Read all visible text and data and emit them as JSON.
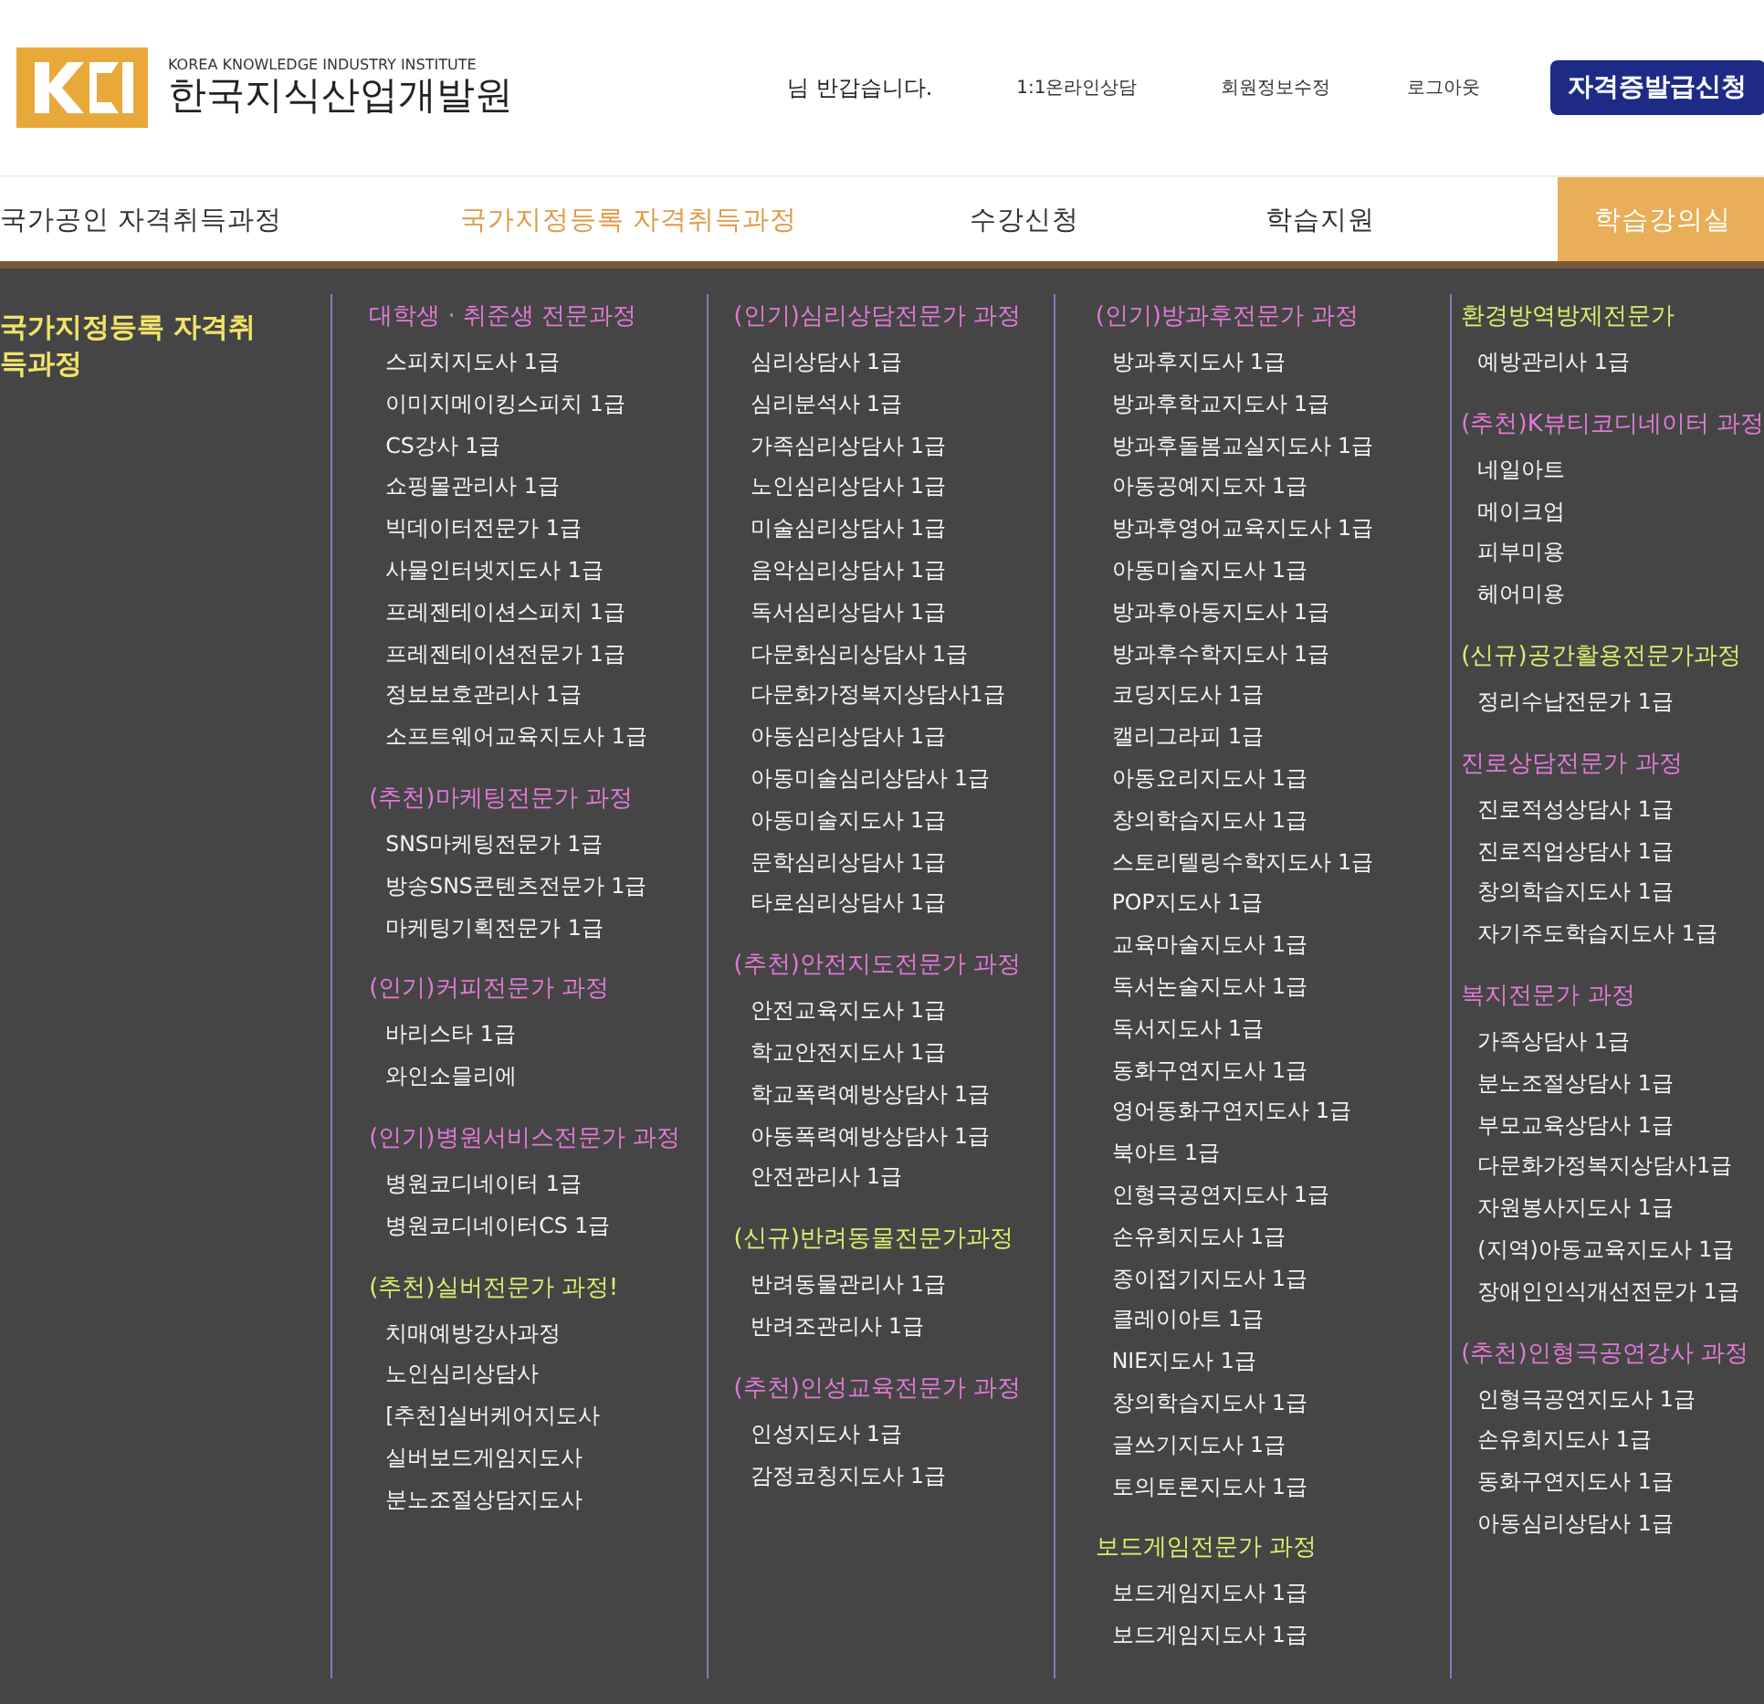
{
  "header": {
    "logo": {
      "subtitle": "KOREA KNOWLEDGE INDUSTRY INSTITUTE",
      "name": "한국지식산업개발원"
    },
    "greeting": "님 반갑습니다.",
    "links": [
      "1:1온라인상담",
      "회원정보수정",
      "로그아웃"
    ],
    "cta": "자격증발급신청"
  },
  "nav": [
    {
      "label": "국가공인 자격취득과정",
      "selected": false,
      "kind": "plain"
    },
    {
      "label": "국가지정등록 자격취득과정",
      "selected": true,
      "kind": "plain"
    },
    {
      "label": "수강신청",
      "selected": false,
      "kind": "plain"
    },
    {
      "label": "학습지원",
      "selected": false,
      "kind": "plain"
    },
    {
      "label": "학습강의실",
      "selected": false,
      "kind": "box"
    }
  ],
  "menu": {
    "title": "국가지정등록 자격취득과정",
    "columns": [
      {
        "groups": [
          {
            "title": "대학생 · 취준생 전문과정",
            "color": "#e07ad8",
            "items": [
              "스피치지도사 1급",
              "이미지메이킹스피치 1급",
              "CS강사 1급",
              "쇼핑몰관리사 1급",
              "빅데이터전문가 1급",
              "사물인터넷지도사 1급",
              "프레젠테이션스피치 1급",
              "프레젠테이션전문가 1급",
              "정보보호관리사 1급",
              "소프트웨어교육지도사 1급"
            ]
          },
          {
            "title": "(추천)마케팅전문가 과정",
            "color": "#e07ad8",
            "items": [
              "SNS마케팅전문가 1급",
              "방송SNS콘텐츠전문가 1급",
              "마케팅기획전문가 1급"
            ]
          },
          {
            "title": "(인기)커피전문가 과정",
            "color": "#e07ad8",
            "items": [
              "바리스타 1급",
              "와인소믈리에"
            ]
          },
          {
            "title": "(인기)병원서비스전문가 과정",
            "color": "#e07ad8",
            "items": [
              "병원코디네이터 1급",
              "병원코디네이터CS 1급"
            ]
          },
          {
            "title": "(추천)실버전문가 과정!",
            "color": "#d8f070",
            "items": [
              "치매예방강사과정",
              "노인심리상담사",
              "[추천]실버케어지도사",
              "실버보드게임지도사",
              "분노조절상담지도사"
            ]
          }
        ]
      },
      {
        "groups": [
          {
            "title": "(인기)심리상담전문가 과정",
            "color": "#e07ad8",
            "items": [
              "심리상담사 1급",
              "심리분석사 1급",
              "가족심리상담사 1급",
              "노인심리상담사 1급",
              "미술심리상담사 1급",
              "음악심리상담사 1급",
              "독서심리상담사 1급",
              "다문화심리상담사 1급",
              "다문화가정복지상담사1급",
              "아동심리상담사 1급",
              "아동미술심리상담사 1급",
              "아동미술지도사 1급",
              "문학심리상담사 1급",
              "타로심리상담사 1급"
            ]
          },
          {
            "title": "(추천)안전지도전문가 과정",
            "color": "#e07ad8",
            "items": [
              "안전교육지도사 1급",
              "학교안전지도사 1급",
              "학교폭력예방상담사 1급",
              "아동폭력예방상담사 1급",
              "안전관리사 1급"
            ]
          },
          {
            "title": "(신규)반려동물전문가과정",
            "color": "#d8f070",
            "items": [
              "반려동물관리사 1급",
              "반려조관리사 1급"
            ]
          },
          {
            "title": "(추천)인성교육전문가 과정",
            "color": "#e07ad8",
            "items": [
              "인성지도사 1급",
              "감정코칭지도사 1급"
            ]
          }
        ]
      },
      {
        "groups": [
          {
            "title": "(인기)방과후전문가 과정",
            "color": "#e07ad8",
            "items": [
              "방과후지도사 1급",
              "방과후학교지도사 1급",
              "방과후돌봄교실지도사 1급",
              "아동공예지도자 1급",
              "방과후영어교육지도사 1급",
              "아동미술지도사 1급",
              "방과후아동지도사 1급",
              "방과후수학지도사 1급",
              "코딩지도사 1급",
              "캘리그라피 1급",
              "아동요리지도사 1급",
              "창의학습지도사 1급",
              "스토리텔링수학지도사 1급",
              "POP지도사 1급",
              "교육마술지도사 1급",
              "독서논술지도사 1급",
              "독서지도사 1급",
              "동화구연지도사 1급",
              "영어동화구연지도사 1급",
              "북아트 1급",
              "인형극공연지도사 1급",
              "손유희지도사 1급",
              "종이접기지도사 1급",
              "클레이아트 1급",
              "NIE지도사 1급",
              "창의학습지도사 1급",
              "글쓰기지도사 1급",
              "토의토론지도사 1급"
            ]
          },
          {
            "title": "보드게임전문가 과정",
            "color": "#d8f070",
            "items": [
              "보드게임지도사 1급",
              "보드게임지도사 1급"
            ]
          }
        ]
      },
      {
        "groups": [
          {
            "title": "환경방역방제전문가",
            "color": "#d8f070",
            "items": [
              "예방관리사 1급"
            ]
          },
          {
            "title": "(추천)K뷰티코디네이터 과정",
            "color": "#e07ad8",
            "items": [
              "네일아트",
              "메이크업",
              "피부미용",
              "헤어미용"
            ]
          },
          {
            "title": "(신규)공간활용전문가과정",
            "color": "#d8f070",
            "items": [
              "정리수납전문가 1급"
            ]
          },
          {
            "title": "진로상담전문가 과정",
            "color": "#e07ad8",
            "items": [
              "진로적성상담사 1급",
              "진로직업상담사 1급",
              "창의학습지도사 1급",
              "자기주도학습지도사 1급"
            ]
          },
          {
            "title": "복지전문가 과정",
            "color": "#e07ad8",
            "items": [
              "가족상담사 1급",
              "분노조절상담사 1급",
              "부모교육상담사 1급",
              "다문화가정복지상담사1급",
              "자원봉사지도사 1급",
              "(지역)아동교육지도사 1급",
              "장애인인식개선전문가 1급"
            ]
          },
          {
            "title": "(추천)인형극공연강사 과정",
            "color": "#e07ad8",
            "items": [
              "인형극공연지도사 1급",
              "손유희지도사 1급",
              "동화구연지도사 1급",
              "아동심리상담사 1급"
            ]
          }
        ]
      }
    ]
  }
}
